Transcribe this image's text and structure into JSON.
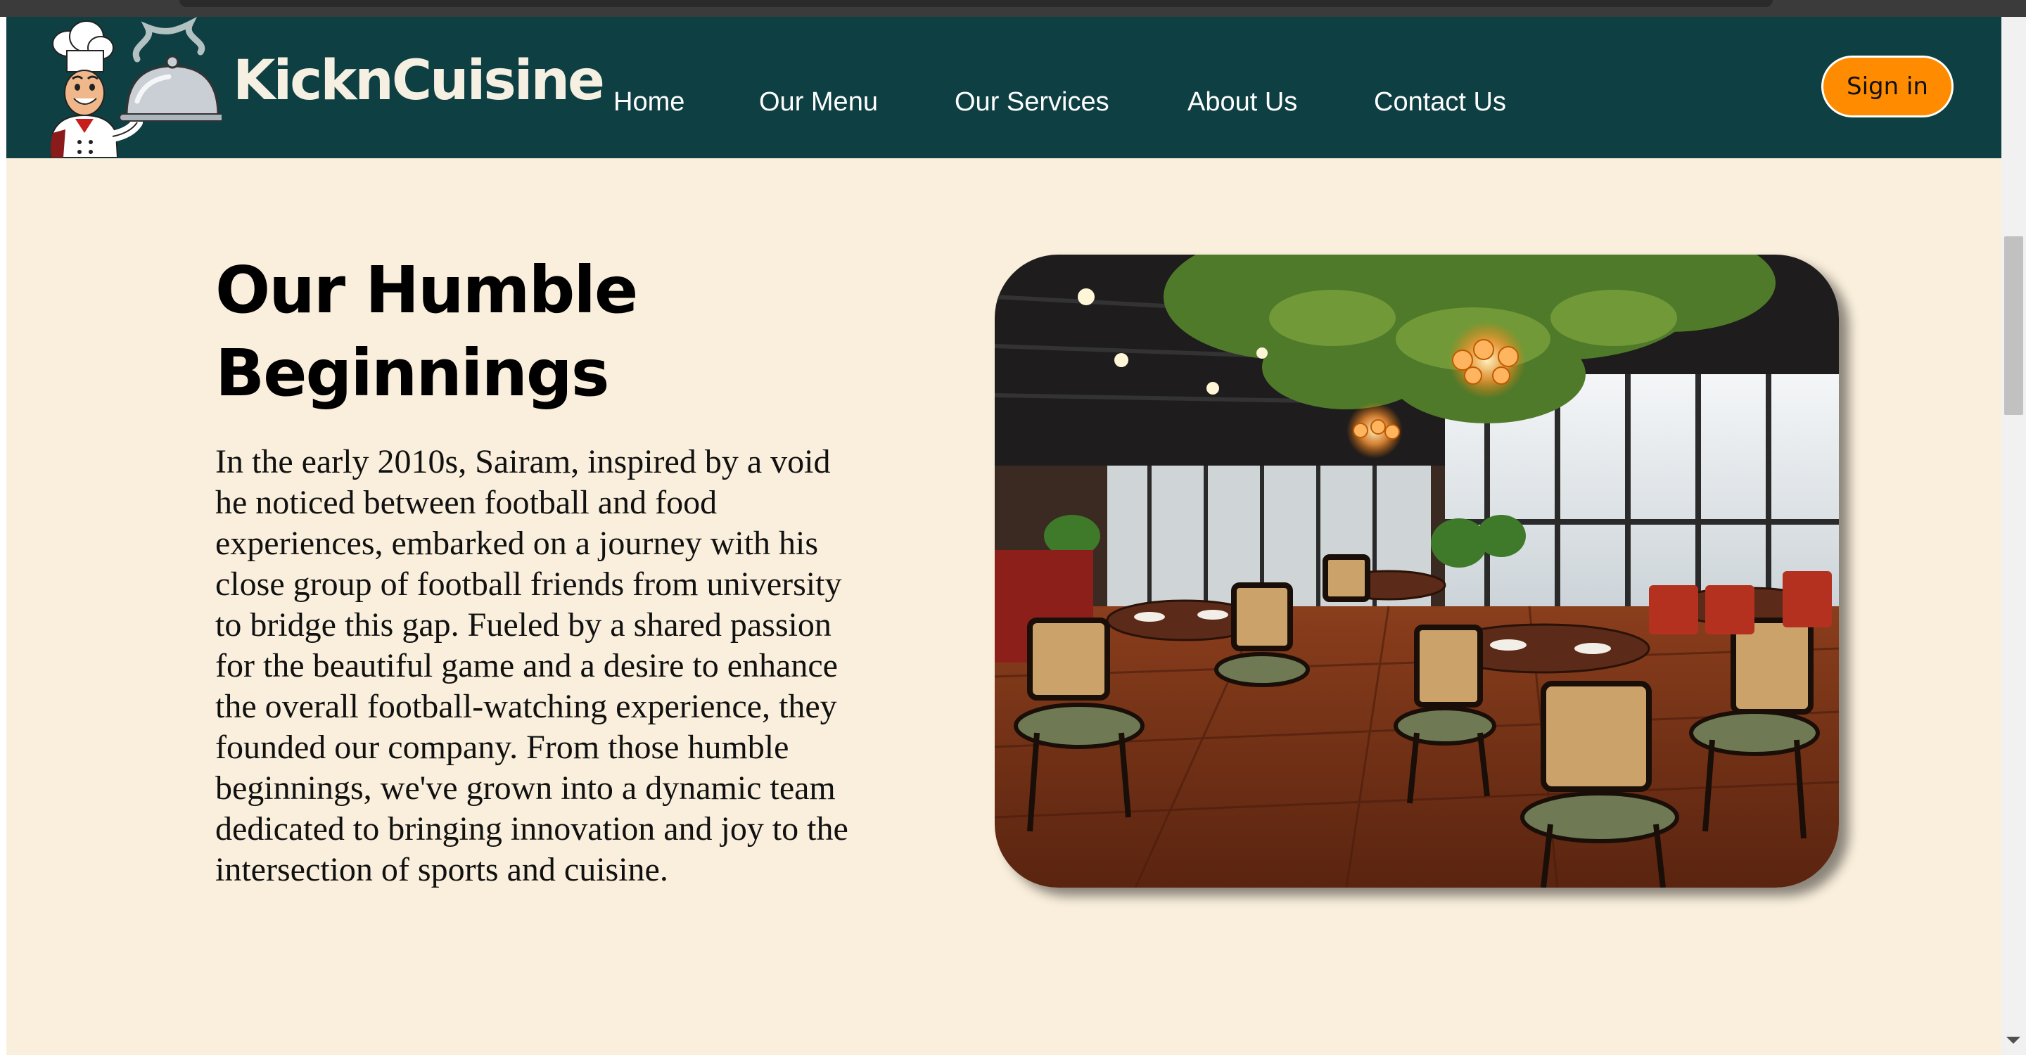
{
  "brand": {
    "name": "KicknCuisine",
    "logo_icon": "chef-with-cloche-icon"
  },
  "nav": {
    "items": [
      {
        "label": "Home"
      },
      {
        "label": "Our Menu"
      },
      {
        "label": "Our Services"
      },
      {
        "label": "About Us"
      },
      {
        "label": "Contact Us"
      }
    ],
    "signin_label": "Sign in"
  },
  "hero": {
    "title": "Our Humble Beginnings",
    "body": "In the early 2010s, Sairam, inspired by a void he noticed between football and food experiences, embarked on a journey with his close group of football friends from university to bridge this gap. Fueled by a shared passion for the beautiful game and a desire to enhance the overall football-watching experience, they founded our company. From those humble beginnings, we've grown into a dynamic team dedicated to bringing innovation and joy to the intersection of sports and cuisine.",
    "image": "restaurant-interior-photo"
  },
  "colors": {
    "navbar": "#0e3f42",
    "page_background": "#faefdc",
    "signin_button": "#ff8c00",
    "brand_text": "#f6f0e2"
  }
}
